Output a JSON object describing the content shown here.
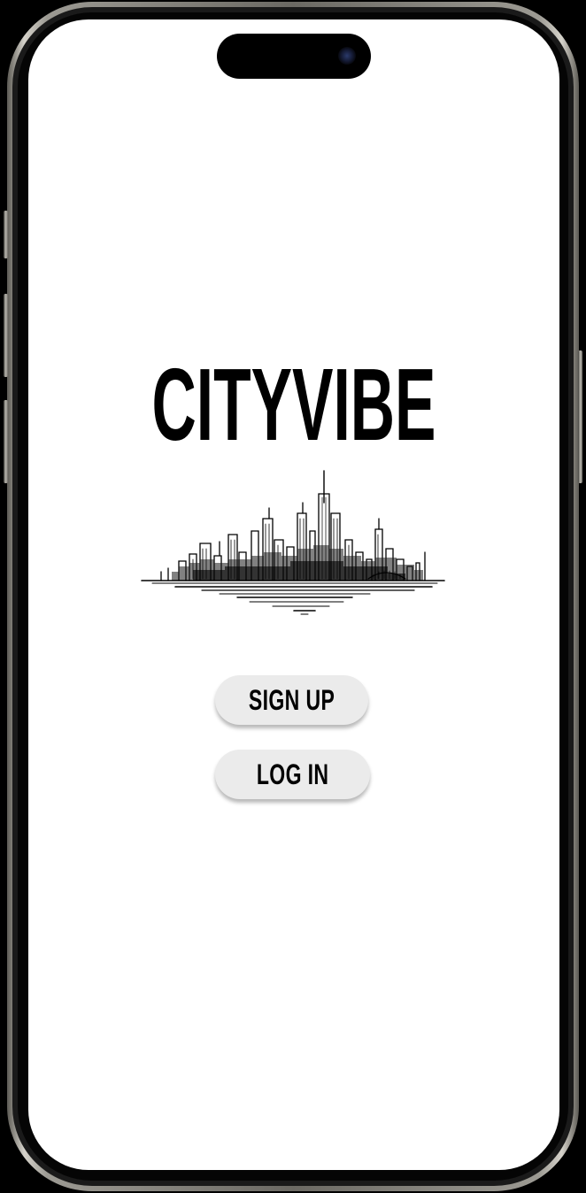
{
  "app": {
    "title": "CITYVIBE",
    "logo_icon": "city-skyline-icon"
  },
  "actions": {
    "signup_label": "SIGN UP",
    "login_label": "LOG IN"
  },
  "colors": {
    "screen_background": "#ffffff",
    "text": "#000000",
    "button_background": "#ebebeb",
    "device_frame": "#9c9a93"
  }
}
